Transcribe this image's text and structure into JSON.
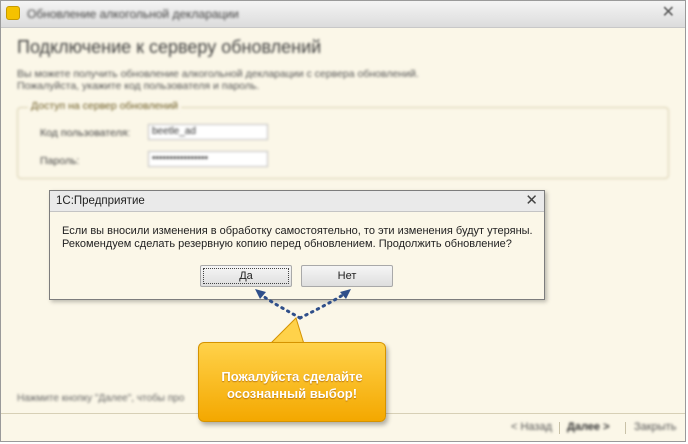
{
  "window": {
    "title": "Обновление алкогольной декларации",
    "close_glyph": "✕"
  },
  "page": {
    "heading": "Подключение к серверу обновлений",
    "description_line1": "Вы можете получить обновление алкогольной декларации с сервера обновлений.",
    "description_line2": "Пожалуйста, укажите код пользователя и пароль."
  },
  "server_access": {
    "legend": "Доступ на сервер обновлений",
    "user_code_label": "Код пользователя:",
    "user_code_value": "beetle_ad",
    "password_label": "Пароль:",
    "password_value": "••••••••••••••••"
  },
  "footer": {
    "hint": "Нажмите кнопку \"Далее\", чтобы про",
    "back_label": "< Назад",
    "next_label": "Далее >",
    "close_label": "Закрыть"
  },
  "dialog": {
    "title": "1С:Предприятие",
    "close_glyph": "✕",
    "message_line1": "Если вы вносили изменения в обработку самостоятельно, то эти изменения будут утеряны.",
    "message_line2": "Рекомендуем сделать резервную копию перед обновлением. Продолжить обновление?",
    "yes_label": "Да",
    "no_label": "Нет"
  },
  "callout": {
    "text": "Пожалуйста сделайте\nосознанный выбор!"
  },
  "colors": {
    "window_background": "#fbf7e8",
    "callout": "#f4a800",
    "arrow": "#2f4f8a"
  },
  "icons": {
    "app_icon": "1c-app-icon",
    "close": "close-icon"
  }
}
